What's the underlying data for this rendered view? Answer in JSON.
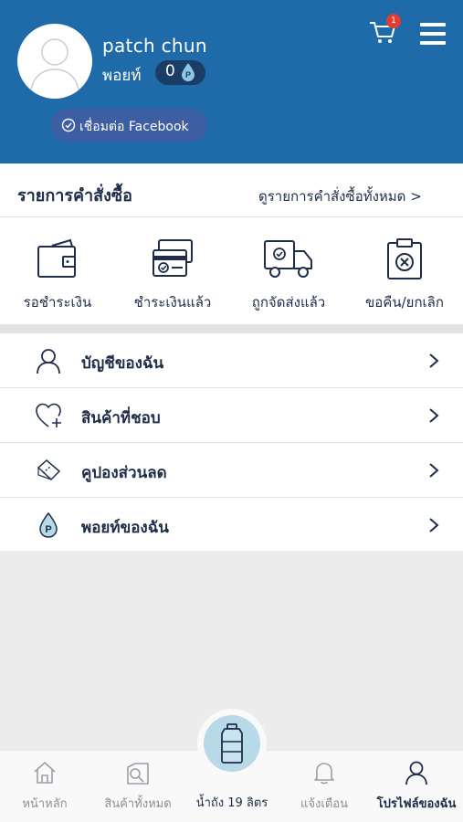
{
  "profile": {
    "name": "patch chun",
    "points_label": "พอยท์",
    "points_value": "0",
    "facebook_label": "เชื่อมต่อ Facebook"
  },
  "cart": {
    "badge_count": "1"
  },
  "orders": {
    "title": "รายการคำสั่งซื้อ",
    "view_all": "ดูรายการคำสั่งซื้อทั้งหมด >",
    "statuses": [
      {
        "label": "รอชำระเงิน",
        "icon": "wallet-icon"
      },
      {
        "label": "ชำระเงินแล้ว",
        "icon": "paid-card-icon"
      },
      {
        "label": "ถูกจัดส่งแล้ว",
        "icon": "delivery-truck-icon"
      },
      {
        "label": "ขอคืน/ยกเลิก",
        "icon": "cancel-clipboard-icon"
      }
    ]
  },
  "menu": [
    {
      "label": "บัญชีของฉัน",
      "icon": "user-icon"
    },
    {
      "label": "สินค้าที่ชอบ",
      "icon": "heart-plus-icon"
    },
    {
      "label": "คูปองส่วนลด",
      "icon": "coupon-icon"
    },
    {
      "label": "พอยท์ของฉัน",
      "icon": "points-drop-icon"
    }
  ],
  "bottom_nav": [
    {
      "label": "หน้าหลัก",
      "icon": "home-icon"
    },
    {
      "label": "สินค้าทั้งหมด",
      "icon": "products-icon"
    },
    {
      "label": "น้ำถัง 19 ลิตร",
      "icon": "water-jug-icon"
    },
    {
      "label": "แจ้งเตือน",
      "icon": "bell-icon"
    },
    {
      "label": "โปรไฟล์ของฉัน",
      "icon": "profile-icon"
    }
  ],
  "colors": {
    "header_bg": "#1f6aa8",
    "navy_text": "#1f2d4a",
    "badge_red": "#e63b2e",
    "fab_bg": "#b8d9e8"
  }
}
